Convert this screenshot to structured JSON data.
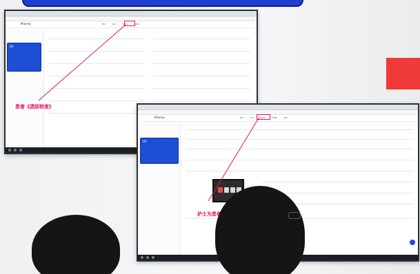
{
  "screens": [
    {
      "app_title": "Miarmy",
      "nav": [
        "HIS",
        "LIS",
        "PACS",
        "EMR"
      ],
      "card_label": "UI",
      "card_sub": "▪▪▪▪",
      "annotation": "患者《透前检查》"
    },
    {
      "app_title": "Miarmy",
      "nav": [
        "HIS",
        "LIS",
        "PACS",
        "EMR",
        "RIS"
      ],
      "card_label": "UI",
      "annotation": "护士为患者进行《透前检"
    }
  ],
  "colors": {
    "annotation": "#e2125c",
    "card_blue": "#1d4fd6",
    "banner_blue": "#1f3fd0",
    "red_sign": "#f03a3a"
  },
  "icons": {
    "help": "help-fab-icon"
  }
}
